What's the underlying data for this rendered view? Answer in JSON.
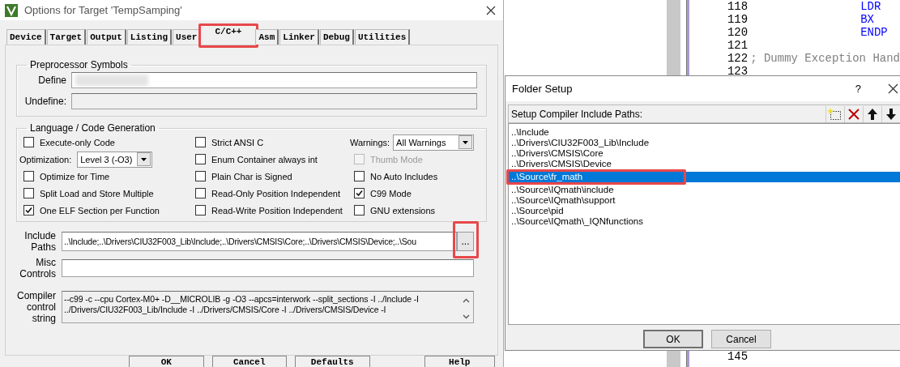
{
  "editor": {
    "top_lines": [
      {
        "number": "118",
        "code": "LDR",
        "kind": "keyword"
      },
      {
        "number": "119",
        "code": "BX",
        "kind": "keyword"
      },
      {
        "number": "120",
        "code": "ENDP",
        "kind": "keyword"
      },
      {
        "number": "121"
      },
      {
        "number": "122",
        "code": "; Dummy Exception Hand",
        "kind": "comment"
      },
      {
        "number": "123"
      }
    ],
    "bottom_lines": [
      {
        "number": "145"
      }
    ]
  },
  "options_dialog": {
    "title": "Options for Target 'TempSamping'",
    "tabs": [
      {
        "label": "Device",
        "selected": false,
        "highlighted": false
      },
      {
        "label": "Target",
        "selected": false,
        "highlighted": false
      },
      {
        "label": "Output",
        "selected": false,
        "highlighted": false
      },
      {
        "label": "Listing",
        "selected": false,
        "highlighted": false
      },
      {
        "label": "User",
        "selected": false,
        "highlighted": false
      },
      {
        "label": "C/C++",
        "selected": true,
        "highlighted": true
      },
      {
        "label": "Asm",
        "selected": false,
        "highlighted": false
      },
      {
        "label": "Linker",
        "selected": false,
        "highlighted": false
      },
      {
        "label": "Debug",
        "selected": false,
        "highlighted": false
      },
      {
        "label": "Utilities",
        "selected": false,
        "highlighted": false
      }
    ],
    "preprocessor": {
      "title": "Preprocessor Symbols",
      "define": {
        "label": "Define",
        "redacted": true
      },
      "undefine": {
        "label": "Undefine:",
        "disabled": true
      }
    },
    "language": {
      "title": "Language / Code Generation",
      "columns": [
        [
          {
            "kind": "checkbox",
            "label": "Execute-only Code",
            "checked": false,
            "disabled": false
          },
          {
            "kind": "dropdown",
            "label": "Optimization:",
            "value": "Level 3 (-O3)"
          },
          {
            "kind": "checkbox",
            "label": "Optimize for Time",
            "checked": false,
            "disabled": false
          },
          {
            "kind": "checkbox",
            "label": "Split Load and Store Multiple",
            "checked": false,
            "disabled": false
          },
          {
            "kind": "checkbox",
            "label": "One ELF Section per Function",
            "checked": true,
            "disabled": false
          }
        ],
        [
          {
            "kind": "checkbox",
            "label": "Strict ANSI C",
            "checked": false,
            "disabled": false
          },
          {
            "kind": "checkbox",
            "label": "Enum Container always int",
            "checked": false,
            "disabled": false
          },
          {
            "kind": "checkbox",
            "label": "Plain Char is Signed",
            "checked": false,
            "disabled": false
          },
          {
            "kind": "checkbox",
            "label": "Read-Only Position Independent",
            "checked": false,
            "disabled": false
          },
          {
            "kind": "checkbox",
            "label": "Read-Write Position Independent",
            "checked": false,
            "disabled": false
          }
        ],
        [
          {
            "kind": "dropdown",
            "label": "Warnings:",
            "value": "All Warnings"
          },
          {
            "kind": "checkbox",
            "label": "Thumb Mode",
            "checked": false,
            "disabled": true
          },
          {
            "kind": "checkbox",
            "label": "No Auto Includes",
            "checked": false,
            "disabled": false
          },
          {
            "kind": "checkbox",
            "label": "C99 Mode",
            "checked": true,
            "disabled": false
          },
          {
            "kind": "checkbox",
            "label": "GNU extensions",
            "checked": false,
            "disabled": false
          }
        ]
      ]
    },
    "include_paths": {
      "label": "Include Paths",
      "value": "..\\Include;..\\Drivers\\CIU32F003_Lib\\Include;..\\Drivers\\CMSIS\\Core;..\\Drivers\\CMSIS\\Device;..\\Sou",
      "browse_button": "...",
      "browse_highlighted": true
    },
    "misc_controls": {
      "label": "Misc Controls"
    },
    "compiler_string": {
      "label": "Compiler control string",
      "value": "--c99 -c --cpu Cortex-M0+ -D__MICROLIB -g -O3 --apcs=interwork --split_sections -I ../Include -I ../Drivers/CIU32F003_Lib/Include -I ../Drivers/CMSIS/Core -I ../Drivers/CMSIS/Device -I"
    },
    "buttons": [
      "OK",
      "Cancel",
      "Defaults",
      "Help"
    ]
  },
  "folder_dialog": {
    "title": "Folder Setup",
    "help": "?",
    "header": "Setup Compiler Include Paths:",
    "paths": [
      {
        "path": "..\\Include",
        "selected": false,
        "highlighted": false
      },
      {
        "path": "..\\Drivers\\CIU32F003_Lib\\Include",
        "selected": false,
        "highlighted": false
      },
      {
        "path": "..\\Drivers\\CMSIS\\Core",
        "selected": false,
        "highlighted": false
      },
      {
        "path": "..\\Drivers\\CMSIS\\Device",
        "selected": false,
        "highlighted": false
      },
      {
        "path": "..\\Source\\fr_math",
        "selected": true,
        "highlighted": true
      },
      {
        "path": "..\\Source\\IQmath\\include",
        "selected": false,
        "highlighted": false
      },
      {
        "path": "..\\Source\\IQmath\\support",
        "selected": false,
        "highlighted": false
      },
      {
        "path": "..\\Source\\pid",
        "selected": false,
        "highlighted": false
      },
      {
        "path": "..\\Source\\IQmath\\_IQNfunctions",
        "selected": false,
        "highlighted": false
      }
    ],
    "buttons": [
      "OK",
      "Cancel"
    ]
  }
}
